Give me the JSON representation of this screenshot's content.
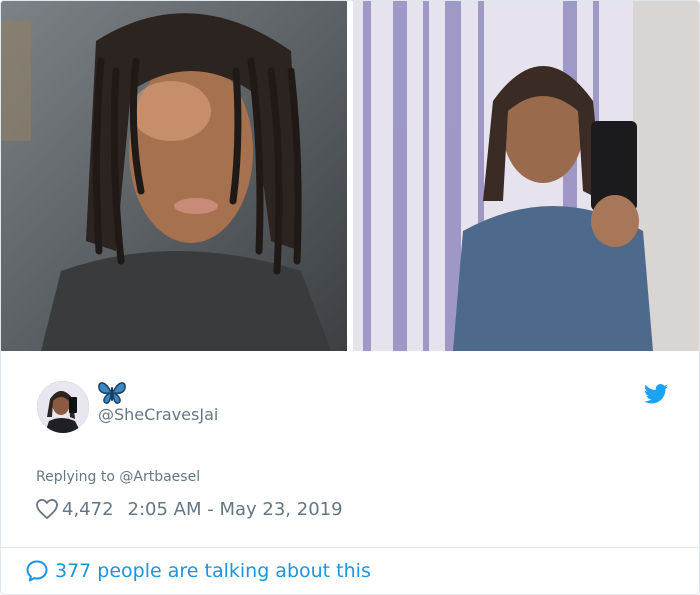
{
  "tweet": {
    "handle": "@SheCravesJai",
    "emoji_icon": "blue-butterfly-icon",
    "replying_prefix": "Replying to ",
    "replying_to": "@Artbaesel",
    "likes": "4,472",
    "timestamp": "2:05 AM - May 23, 2019",
    "talking": "377 people are talking about this"
  },
  "colors": {
    "twitter_blue": "#1da1f2",
    "link_blue": "#1b95e0",
    "meta_gray": "#657786",
    "border": "#e1e8ed"
  },
  "icons": {
    "bird": "twitter-bird-icon",
    "heart": "heart-outline-icon",
    "bubble": "speech-bubble-icon"
  }
}
